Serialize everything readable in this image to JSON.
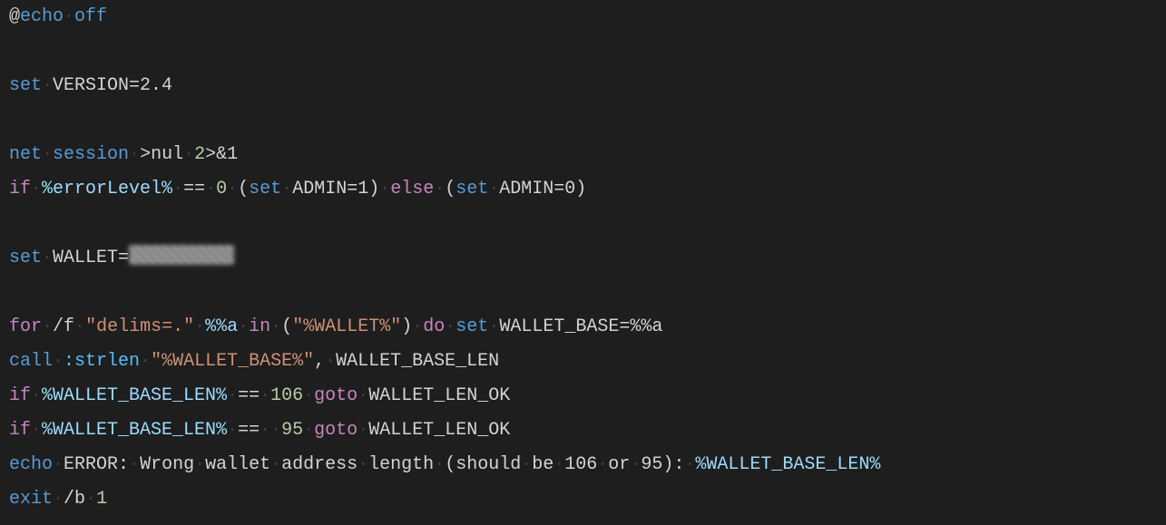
{
  "code": {
    "l1": {
      "at": "@",
      "echo": "echo",
      "off": "off"
    },
    "l3": {
      "set": "set",
      "assign": "VERSION=2.4"
    },
    "l5": {
      "net": "net",
      "session": "session",
      "red1": ">nul",
      "two": "2",
      "red2": ">&1"
    },
    "l6": {
      "if": "if",
      "var": "%errorLevel%",
      "eq": "==",
      "zero": "0",
      "op": "(",
      "set1": "set",
      "a1": "ADMIN=1)",
      "else": "else",
      "op2": "(",
      "set2": "set",
      "a0": "ADMIN=0)"
    },
    "l8": {
      "set": "set",
      "assign": "WALLET="
    },
    "l10": {
      "for": "for",
      "f": "/f",
      "delims": "\"delims=.\"",
      "va": "%%a",
      "in": "in",
      "op": "(",
      "wal": "\"%WALLET%\"",
      "cp": ")",
      "do": "do",
      "set": "set",
      "assign": "WALLET_BASE=%%a"
    },
    "l11": {
      "call": "call",
      "label": ":strlen",
      "arg1": "\"%WALLET_BASE%\"",
      "comma": ",",
      "arg2": "WALLET_BASE_LEN"
    },
    "l12": {
      "if": "if",
      "var": "%WALLET_BASE_LEN%",
      "eq": "==",
      "n": "106",
      "goto": "goto",
      "lbl": "WALLET_LEN_OK"
    },
    "l13": {
      "if": "if",
      "var": "%WALLET_BASE_LEN%",
      "eq": "==",
      "sp": "",
      "n": "95",
      "goto": "goto",
      "lbl": "WALLET_LEN_OK"
    },
    "l14": {
      "echo": "echo",
      "msg1": "ERROR:",
      "msg2": "Wrong",
      "msg3": "wallet",
      "msg4": "address",
      "msg5": "length",
      "msg6": "(should",
      "msg7": "be",
      "msg8": "106",
      "msg9": "or",
      "msg10": "95):",
      "var": "%WALLET_BASE_LEN%"
    },
    "l15": {
      "exit": "exit",
      "b": "/b",
      "one": "1"
    }
  }
}
